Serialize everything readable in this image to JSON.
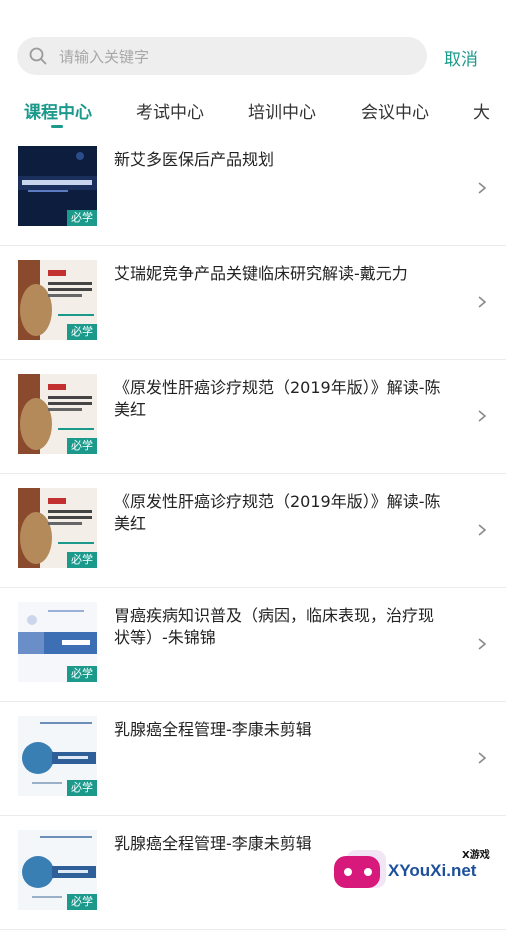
{
  "colors": {
    "accent": "#1b9a8c",
    "badge": "#1b9a8c"
  },
  "search": {
    "placeholder": "请输入关键字",
    "value": "",
    "cancel_label": "取消"
  },
  "tabs": [
    {
      "label": "课程中心",
      "active": true
    },
    {
      "label": "考试中心",
      "active": false
    },
    {
      "label": "培训中心",
      "active": false
    },
    {
      "label": "会议中心",
      "active": false
    },
    {
      "label": "大",
      "active": false
    }
  ],
  "courses": [
    {
      "title": "新艾多医保后产品规划",
      "badge": "必学",
      "thumb": "dark-blue"
    },
    {
      "title": "艾瑞妮竞争产品关键临床研究解读-戴元力",
      "badge": "必学",
      "thumb": "lion"
    },
    {
      "title": "《原发性肝癌诊疗规范（2019年版）》解读-陈美红",
      "badge": "必学",
      "thumb": "lion"
    },
    {
      "title": "《原发性肝癌诊疗规范（2019年版）》解读-陈美红",
      "badge": "必学",
      "thumb": "lion"
    },
    {
      "title": "胃癌疾病知识普及（病因，临床表现，治疗现状等）-朱锦锦",
      "badge": "必学",
      "thumb": "blue-slide"
    },
    {
      "title": "乳腺癌全程管理-李康未剪辑",
      "badge": "必学",
      "thumb": "globe-slide"
    },
    {
      "title": "乳腺癌全程管理-李康未剪辑",
      "badge": "必学",
      "thumb": "globe-slide"
    }
  ],
  "watermark": {
    "text": "XYouXi.net",
    "small": "X游戏"
  }
}
